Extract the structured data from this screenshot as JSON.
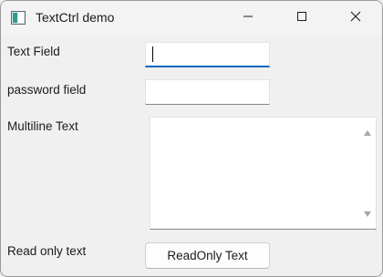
{
  "window": {
    "title": "TextCtrl demo",
    "icons": {
      "app": "app-window-icon",
      "minimize": "minimize-icon",
      "maximize": "maximize-icon",
      "close": "close-icon"
    }
  },
  "form": {
    "text_field": {
      "label": "Text Field",
      "value": ""
    },
    "password_field": {
      "label": "password field",
      "value": ""
    },
    "multiline": {
      "label": "Multiline Text",
      "value": ""
    },
    "readonly": {
      "label": "Read only text",
      "value": "ReadOnly Text"
    }
  },
  "colors": {
    "focus_accent": "#0067c0",
    "window_bg": "#f0f0f0",
    "field_bg": "#ffffff"
  }
}
